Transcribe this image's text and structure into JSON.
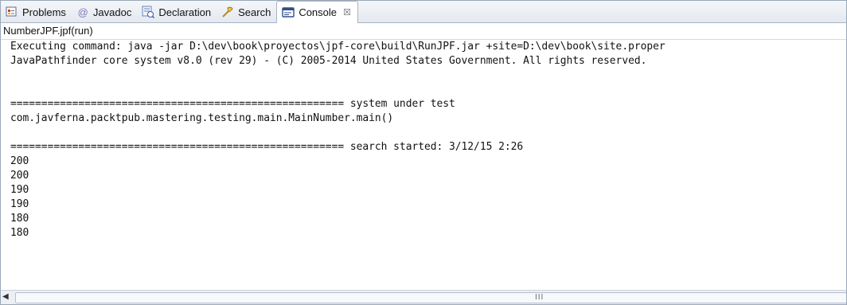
{
  "tabs": [
    {
      "label": "Problems",
      "icon": "problems-icon"
    },
    {
      "label": "Javadoc",
      "icon": "javadoc-icon"
    },
    {
      "label": "Declaration",
      "icon": "declaration-icon"
    },
    {
      "label": "Search",
      "icon": "search-icon"
    },
    {
      "label": "Console",
      "icon": "console-icon",
      "active": true
    }
  ],
  "tab_close_glyph": "☒",
  "console_title": "NumberJPF.jpf(run)",
  "output_lines": [
    "Executing command: java -jar D:\\dev\\book\\proyectos\\jpf-core\\build\\RunJPF.jar +site=D:\\dev\\book\\site.proper",
    "JavaPathfinder core system v8.0 (rev 29) - (C) 2005-2014 United States Government. All rights reserved.",
    "",
    "",
    "====================================================== system under test",
    "com.javferna.packtpub.mastering.testing.main.MainNumber.main()",
    "",
    "====================================================== search started: 3/12/15 2:26",
    "200",
    "200",
    "190",
    "190",
    "180",
    "180"
  ],
  "scrollbar": {
    "left_arrow": "◀",
    "grip": "III"
  }
}
